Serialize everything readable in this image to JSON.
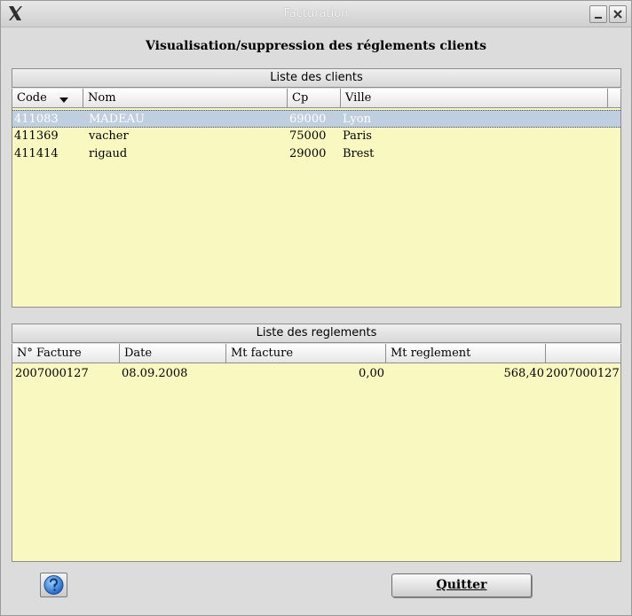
{
  "window": {
    "title": "Facturation"
  },
  "heading": "Visualisation/suppression des réglements clients",
  "clients": {
    "panel_title": "Liste des clients",
    "columns": [
      "Code",
      "Nom",
      "Cp",
      "Ville"
    ],
    "sort_column": "Code",
    "rows": [
      {
        "code": "411083",
        "nom": "MADEAU",
        "cp": "69000",
        "ville": "Lyon",
        "selected": true
      },
      {
        "code": "411369",
        "nom": "vacher",
        "cp": "75000",
        "ville": "Paris",
        "selected": false
      },
      {
        "code": "411414",
        "nom": "rigaud",
        "cp": "29000",
        "ville": "Brest",
        "selected": false
      }
    ]
  },
  "reglements": {
    "panel_title": "Liste des reglements",
    "columns": [
      "N° Facture",
      "Date",
      "Mt facture",
      "Mt reglement",
      ""
    ],
    "rows": [
      {
        "facture": "2007000127",
        "date": "08.09.2008",
        "mt_facture": "0,00",
        "mt_reglement": "568,40",
        "extra": "2007000127"
      }
    ]
  },
  "buttons": {
    "quit": "Quitter",
    "help_icon": "help-globe-icon"
  },
  "colors": {
    "table_bg": "#f8f8c0",
    "selection_bg": "#c0cfe0",
    "window_bg": "#dcdcdc",
    "help_blue": "#2f7fd8"
  }
}
